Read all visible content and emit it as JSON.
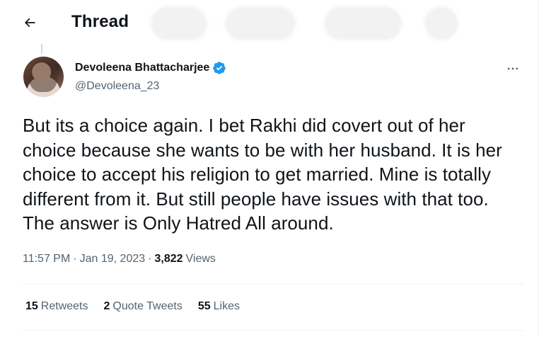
{
  "header": {
    "title": "Thread",
    "back_icon": "arrow-left-icon"
  },
  "tweet": {
    "author": {
      "display_name": "Devoleena Bhattacharjee",
      "handle": "@Devoleena_23",
      "verified_icon": "verified-badge-icon",
      "verified_color": "#1d9bf0"
    },
    "more_icon": "more-horizontal-icon",
    "text": "But its a choice again. I bet Rakhi did covert out of her choice because she wants to be with her husband. It is her choice to accept his religion to get married. Mine is totally different from it. But still people have issues with that too. The answer is Only Hatred All around.",
    "time": "11:57 PM",
    "separator": "·",
    "date": "Jan 19, 2023",
    "views_count": "3,822",
    "views_label": "Views"
  },
  "stats": {
    "retweets_count": "15",
    "retweets_label": "Retweets",
    "quotes_count": "2",
    "quotes_label": "Quote Tweets",
    "likes_count": "55",
    "likes_label": "Likes"
  },
  "colors": {
    "text_primary": "#0f1419",
    "text_secondary": "#536471",
    "divider": "#eff3f4",
    "accent": "#1d9bf0"
  }
}
